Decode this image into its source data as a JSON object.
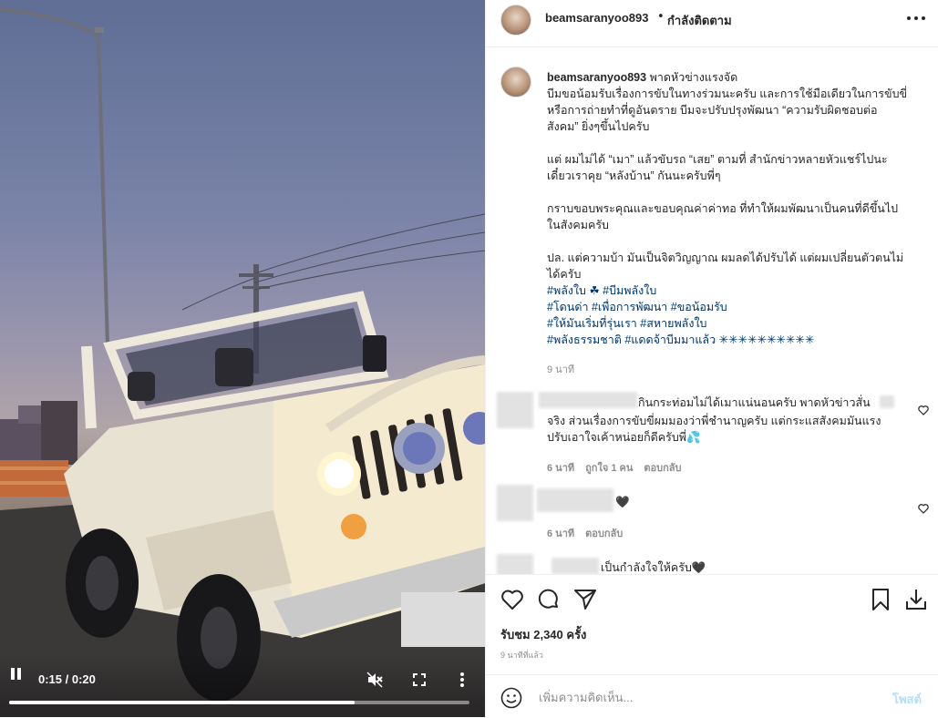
{
  "video": {
    "time": "0:15 / 0:20",
    "progress": 0.75
  },
  "header": {
    "username": "beamsaranyoo893",
    "separator": "•",
    "follow_status": "กำลังติดตาม"
  },
  "caption": {
    "username": "beamsaranyoo893",
    "title": "พาดหัวข่างแรงจัด",
    "lines": [
      "บีมขอน้อมรับเรื่องการขับในทางร่วมนะครับ และการใช้มือเดียวในการขับขี่",
      "หรือการถ่ายทำที่ดูอันตราย บีมจะปรับปรุงพัฒนา “ความรับผิดชอบต่อ",
      "สังคม” ยิ่งๆขึ้นไปครับ",
      "",
      "แต่ ผมไม่ได้ “เมา” แล้วขับรถ “เสย” ตามที่ สำนักข่าวหลายหัวแชร์ไปนะ",
      "เดี๋ยวเราคุย “หลังบ้าน” กันนะครับพี่ๆ",
      "",
      "กราบขอบพระคุณและขอบคุณค่าค่าทอ ที่ทำให้ผมพัฒนาเป็นคนที่ดีขึ้นไป",
      "ในสังคมครับ",
      "",
      "ปล. แต่ความบ้า มันเป็นจิตวิญญาณ ผมลดได้ปรับได้ แต่ผมเปลี่ยนตัวตนไม่",
      "ได้ครับ"
    ],
    "hashtags": [
      "#พลังใบ ☘ #บีมพลังใบ",
      "#โดนด่า #เพื่อการพัฒนา #ขอน้อมรับ",
      "#ให้มันเริ่มที่รุ่นเรา #สหายพลังใบ",
      "#พลังธรรมชาติ #แดดจ้าบีมมาแล้ว ✳✳✳✳✳✳✳✳✳✳"
    ],
    "time": "9 นาที"
  },
  "comments": [
    {
      "text_lines": [
        "กินกระท่อมไม่ได้เมาแน่นอนครับ พาดหัวข่าวสั่น",
        "จริง ส่วนเรื่องการขับขี่ผมมองว่าพี่ชำนาญครับ แต่กระแสสังคมมันแรง",
        "ปรับเอาใจเค้าหน่อยก็ดีครับพี่💦"
      ],
      "time": "6 นาที",
      "likes": "ถูกใจ 1 คน",
      "reply": "ตอบกลับ"
    },
    {
      "text_lines": [
        "🖤"
      ],
      "time": "6 นาที",
      "reply": "ตอบกลับ"
    },
    {
      "text_lines": [
        "เป็นกำลังใจให้ครับ🖤"
      ]
    }
  ],
  "actions": {
    "likes": "รับชม 2,340 ครั้ง",
    "posted": "9 นาทีที่แล้ว"
  },
  "composer": {
    "placeholder": "เพิ่มความคิดเห็น...",
    "post_label": "โพสต์"
  }
}
